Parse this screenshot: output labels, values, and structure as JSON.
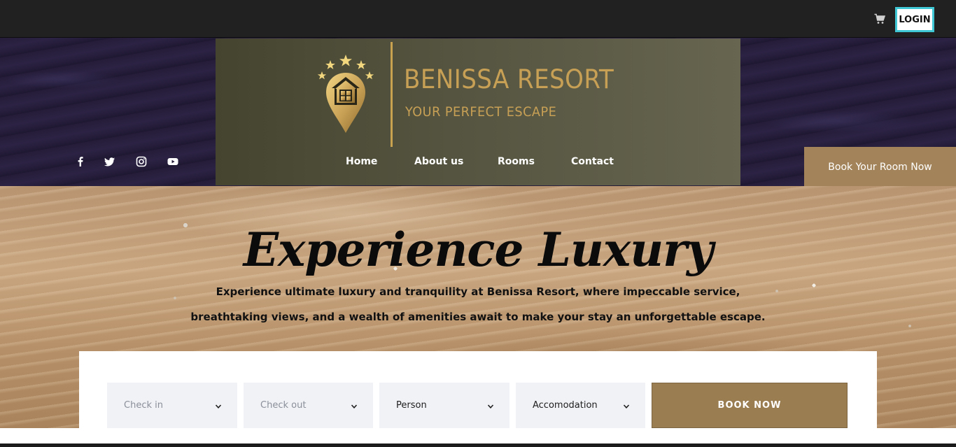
{
  "topbar": {
    "cart_icon": "shopping-cart-icon",
    "login_label": "LOGIN"
  },
  "brand": {
    "name": "BENISSA RESORT",
    "tagline": "YOUR PERFECT ESCAPE",
    "logo_icon": "house-pin-with-stars-icon",
    "gold": "#c8a055"
  },
  "social": [
    {
      "name": "facebook",
      "icon": "facebook-icon"
    },
    {
      "name": "twitter",
      "icon": "twitter-icon"
    },
    {
      "name": "instagram",
      "icon": "instagram-icon"
    },
    {
      "name": "youtube",
      "icon": "youtube-icon"
    }
  ],
  "nav": {
    "items": [
      {
        "label": "Home"
      },
      {
        "label": "About us"
      },
      {
        "label": "Rooms"
      },
      {
        "label": "Contact"
      }
    ]
  },
  "cta": {
    "book_room_label": "Book Your Room Now"
  },
  "hero": {
    "title": "Experience Luxury",
    "line1": "Experience ultimate luxury and tranquility at Benissa Resort, where impeccable service,",
    "line2": "breathtaking views, and a wealth of amenities await to make your stay an unforgettable escape."
  },
  "booking": {
    "fields": [
      {
        "label": "Check in",
        "is_placeholder": true
      },
      {
        "label": "Check out",
        "is_placeholder": true
      },
      {
        "label": "Person",
        "is_placeholder": false
      },
      {
        "label": "Accomodation",
        "is_placeholder": false
      }
    ],
    "submit_label": "BOOK NOW",
    "accent": "#9b7d52"
  },
  "colors": {
    "topbar": "#212121",
    "login_border": "#3fc7d6",
    "header_band": "#241c38",
    "cta_bg": "#a3845a"
  }
}
